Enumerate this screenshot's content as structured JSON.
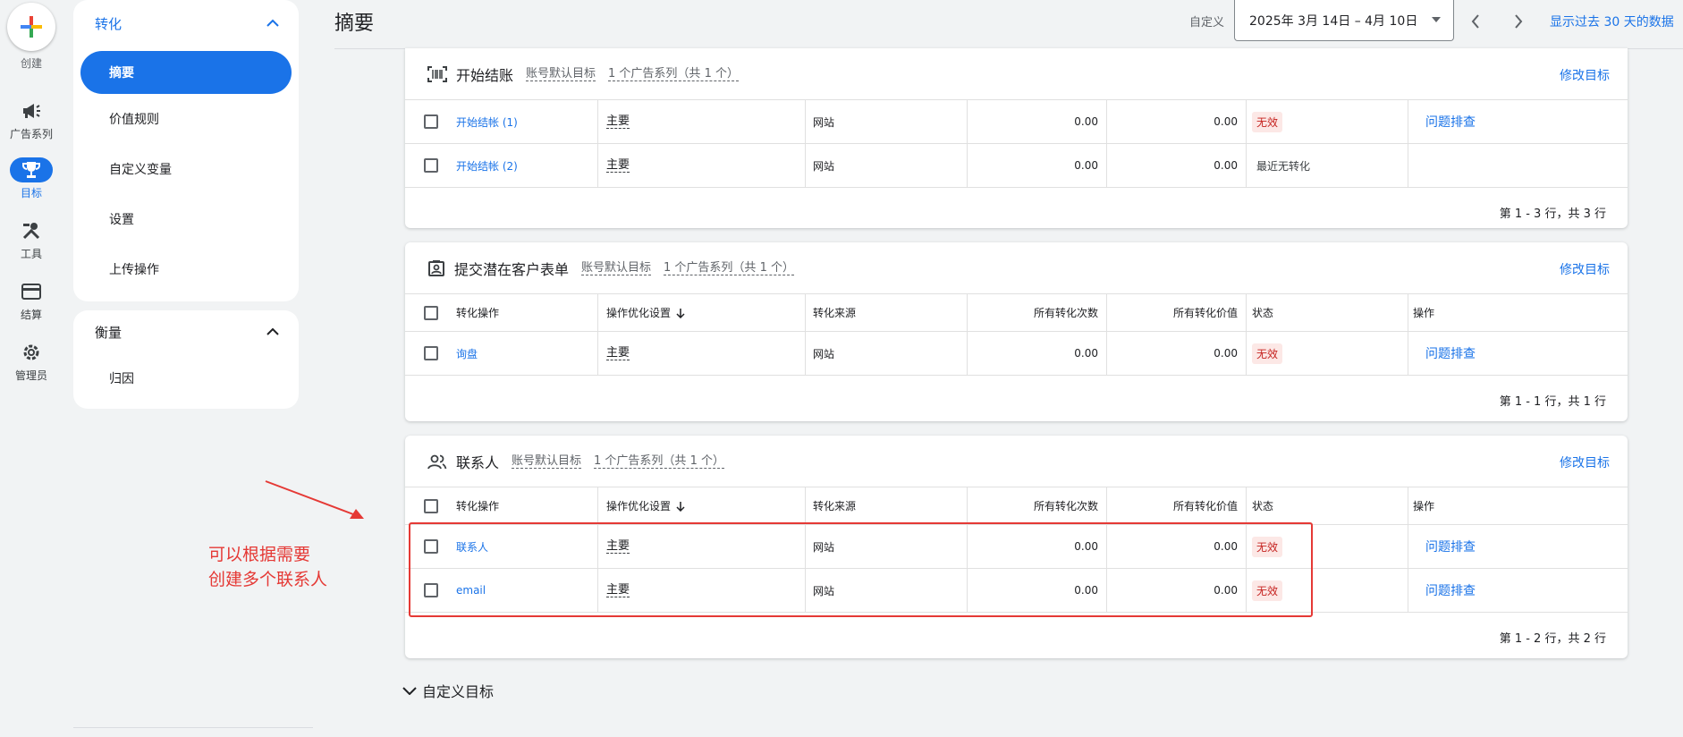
{
  "rail": {
    "create_label": "创建",
    "items": [
      {
        "label": "广告系列",
        "icon": "megaphone-icon"
      },
      {
        "label": "目标",
        "icon": "trophy-icon",
        "active": true
      },
      {
        "label": "工具",
        "icon": "tools-icon"
      },
      {
        "label": "结算",
        "icon": "credit-card-icon"
      },
      {
        "label": "管理员",
        "icon": "gear-icon"
      }
    ]
  },
  "nav": {
    "section1": {
      "title": "转化",
      "items": [
        "摘要",
        "价值规则",
        "自定义变量",
        "设置",
        "上传操作"
      ]
    },
    "section2": {
      "title": "衡量",
      "items": [
        "归因"
      ]
    }
  },
  "header": {
    "title": "摘要",
    "date_caption": "自定义",
    "date_range": "2025年 3月 14日 – 4月 10日",
    "show_30": "显示过去 30 天的数据"
  },
  "table_headers": {
    "action": "转化操作",
    "opt": "操作优化设置",
    "sort_icon": "arrow-down-icon",
    "source": "转化来源",
    "count": "所有转化次数",
    "value": "所有转化价值",
    "status": "状态",
    "ops": "操作"
  },
  "cards": [
    {
      "title": "开始结账",
      "sub1": "账号默认目标",
      "sub2": "1 个广告系列（共 1 个）",
      "edit": "修改目标",
      "rows": [
        {
          "name": "开始结帐 (1)",
          "opt": "主要",
          "source": "网站",
          "count": "0.00",
          "value": "0.00",
          "status": "无效",
          "status_type": "bad",
          "action": "问题排查"
        },
        {
          "name": "开始结帐 (2)",
          "opt": "主要",
          "source": "网站",
          "count": "0.00",
          "value": "0.00",
          "status": "最近无转化",
          "status_type": "neutral",
          "action": ""
        }
      ],
      "footer": "第 1 - 3 行，共 3 行"
    },
    {
      "title": "提交潜在客户表单",
      "sub1": "账号默认目标",
      "sub2": "1 个广告系列（共 1 个）",
      "edit": "修改目标",
      "rows": [
        {
          "name": "询盘",
          "opt": "主要",
          "source": "网站",
          "count": "0.00",
          "value": "0.00",
          "status": "无效",
          "status_type": "bad",
          "action": "问题排查"
        }
      ],
      "footer": "第 1 - 1 行，共 1 行"
    },
    {
      "title": "联系人",
      "sub1": "账号默认目标",
      "sub2": "1 个广告系列（共 1 个）",
      "edit": "修改目标",
      "rows": [
        {
          "name": "联系人",
          "opt": "主要",
          "source": "网站",
          "count": "0.00",
          "value": "0.00",
          "status": "无效",
          "status_type": "bad",
          "action": "问题排查"
        },
        {
          "name": "email",
          "opt": "主要",
          "source": "网站",
          "count": "0.00",
          "value": "0.00",
          "status": "无效",
          "status_type": "bad",
          "action": "问题排查"
        }
      ],
      "footer": "第 1 - 2 行，共 2 行"
    }
  ],
  "custom_goals": "自定义目标",
  "annotation": {
    "line1": "可以根据需要",
    "line2": "创建多个联系人",
    "color": "#e53935"
  },
  "colors": {
    "accent": "#1a73e8",
    "error_bg": "#fce8e6",
    "error_text": "#c5221f"
  }
}
